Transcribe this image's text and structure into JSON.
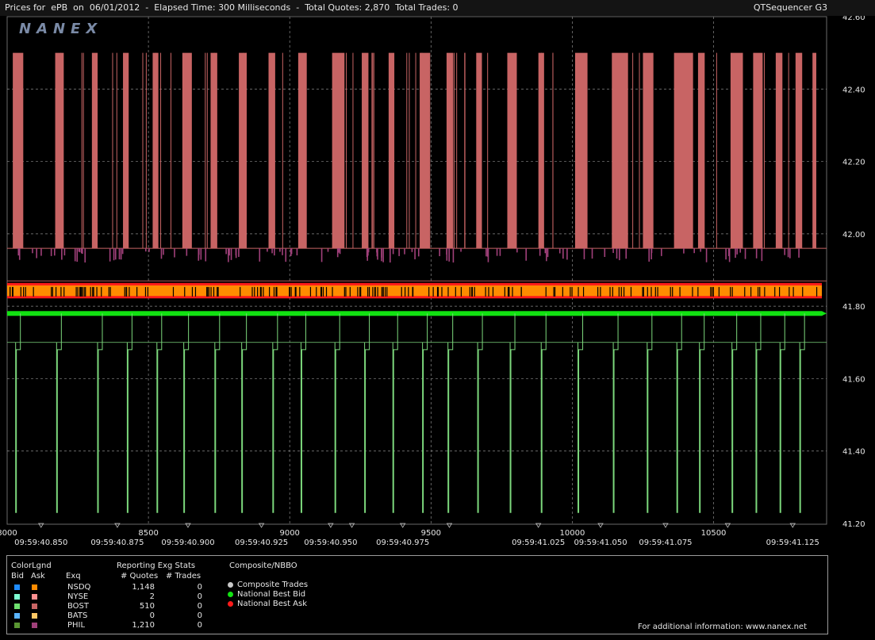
{
  "header": {
    "prices_for_label": "Prices for",
    "symbol": "ePB",
    "on_label": "on",
    "date": "06/01/2012",
    "elapsed_label": "Elapsed Time:",
    "elapsed_value": "300 Milliseconds",
    "total_quotes_label": "Total Quotes:",
    "total_quotes_value": "2,870",
    "total_trades_label": "Total Trades:",
    "total_trades_value": "0",
    "app_name": "QTSequencer G3",
    "watermark": "NANEX"
  },
  "colors": {
    "background": "#000000",
    "ask_pink": "#c86464",
    "phil_ask": "#a0407a",
    "bid_green": "#7cd87c",
    "nbbo_bid": "#12e212",
    "nbbo_ask": "#ff1a1a",
    "nsdq_ask_band": "#ff8c00",
    "grid": "#8a8a8a"
  },
  "chart_data": {
    "type": "line",
    "y_axis": {
      "min": 41.2,
      "max": 42.6,
      "ticks": [
        "42.60",
        "42.40",
        "42.20",
        "42.00",
        "41.80",
        "41.60",
        "41.40",
        "41.20"
      ],
      "position": "right"
    },
    "x_axis_sequence": {
      "min": 8000,
      "max": 10900,
      "ticks": [
        "8000",
        "8500",
        "9000",
        "9500",
        "10000",
        "10500"
      ]
    },
    "x_axis_time_labels": [
      {
        "seq": 8120,
        "label": "09:59:40.850"
      },
      {
        "seq": 8390,
        "label": "09:59:40.875"
      },
      {
        "seq": 8640,
        "label": "09:59:40.900"
      },
      {
        "seq": 8900,
        "label": "09:59:40.925"
      },
      {
        "seq": 9145,
        "label": "09:59:40.950"
      },
      {
        "seq": 9400,
        "label": "09:59:40.975"
      },
      {
        "seq": 9880,
        "label": "09:59:41.025"
      },
      {
        "seq": 10100,
        "label": "09:59:41.050"
      },
      {
        "seq": 10330,
        "label": "09:59:41.075"
      },
      {
        "seq": 10780,
        "label": "09:59:41.125"
      }
    ],
    "series": [
      {
        "name": "National Best Bid",
        "level": 41.78
      },
      {
        "name": "National Best Ask",
        "level": 41.86
      },
      {
        "name": "NSDQ Ask",
        "level": 41.84
      },
      {
        "name": "BOST Ask",
        "low": 41.96,
        "high": 42.5
      },
      {
        "name": "PHIL Ask",
        "low": 41.92,
        "high": 41.96
      },
      {
        "name": "BOST Bid",
        "low": 41.23,
        "high": 41.7
      }
    ],
    "grid": true
  },
  "legend": {
    "colorlgnd_label": "ColorLgnd",
    "bid_label": "Bid",
    "ask_label": "Ask",
    "exq_label": "Exq",
    "stats_title": "Reporting Exg Stats",
    "quotes_header": "# Quotes",
    "trades_header": "# Trades",
    "composite_title": "Composite/NBBO",
    "rows": [
      {
        "exq": "NSDQ",
        "quotes": "1,148",
        "trades": "0",
        "bid_color": "#1e8cff",
        "ask_color": "#ff8c00"
      },
      {
        "exq": "NYSE",
        "quotes": "2",
        "trades": "0",
        "bid_color": "#7dffd2",
        "ask_color": "#ff9090"
      },
      {
        "exq": "BOST",
        "quotes": "510",
        "trades": "0",
        "bid_color": "#6ee06e",
        "ask_color": "#c86464"
      },
      {
        "exq": "BATS",
        "quotes": "0",
        "trades": "0",
        "bid_color": "#5ab4ff",
        "ask_color": "#ffc864"
      },
      {
        "exq": "PHIL",
        "quotes": "1,210",
        "trades": "0",
        "bid_color": "#5a9632",
        "ask_color": "#a0407a"
      }
    ],
    "composite_items": [
      {
        "label": "Composite Trades",
        "color": "#c8c8c8"
      },
      {
        "label": "National Best Bid",
        "color": "#12e212"
      },
      {
        "label": "National Best Ask",
        "color": "#ff1a1a"
      }
    ],
    "footer": "For additional information: www.nanex.net"
  }
}
